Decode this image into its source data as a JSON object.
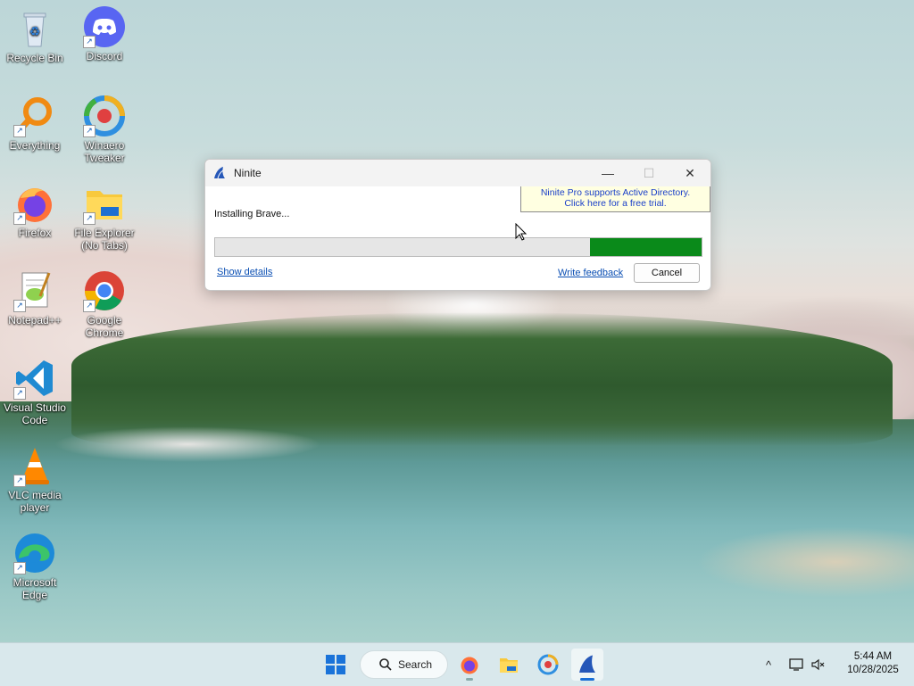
{
  "desktop": {
    "icons": [
      {
        "label": "Recycle Bin",
        "icon": "recycle-bin-icon"
      },
      {
        "label": "Discord",
        "icon": "discord-icon"
      },
      {
        "label": "Everything",
        "icon": "everything-search-icon"
      },
      {
        "label": "Winaero Tweaker",
        "icon": "winaero-tweaker-icon"
      },
      {
        "label": "Firefox",
        "icon": "firefox-icon"
      },
      {
        "label": "File Explorer (No Tabs)",
        "icon": "file-explorer-icon"
      },
      {
        "label": "Notepad++",
        "icon": "notepad-plus-plus-icon"
      },
      {
        "label": "Google Chrome",
        "icon": "chrome-icon"
      },
      {
        "label": "Visual Studio Code",
        "icon": "vscode-icon"
      },
      {
        "label": "VLC media player",
        "icon": "vlc-icon"
      },
      {
        "label": "Microsoft Edge",
        "icon": "edge-icon"
      }
    ]
  },
  "window": {
    "title": "Ninite",
    "icon": "ninite-icon",
    "pro_line1": "Ninite Pro supports Active Directory.",
    "pro_line2": "Click here for a free trial.",
    "status": "Installing Brave...",
    "progress_fraction": 0.23,
    "show_details": "Show details",
    "write_feedback": "Write feedback",
    "cancel": "Cancel",
    "controls": {
      "minimize": "—",
      "maximize": "☐",
      "close": "✕"
    },
    "colors": {
      "progress": "#0a8a1a",
      "pro_box": "#ffffe1",
      "link": "#0b4fb3"
    }
  },
  "taskbar": {
    "search_label": "Search",
    "apps": [
      "start-icon",
      "firefox-icon",
      "file-explorer-icon",
      "winaero-tweaker-icon",
      "ninite-icon"
    ],
    "tray": {
      "chevron": "^",
      "network_icon": "network-icon",
      "volume_icon": "volume-muted-icon"
    },
    "time": "5:44 AM",
    "date": "10/28/2025"
  }
}
